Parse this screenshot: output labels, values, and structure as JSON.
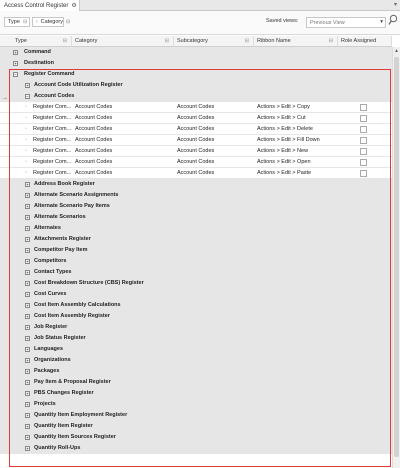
{
  "tab": {
    "title": "Access Control Register",
    "gear_icon": "gear-icon",
    "arrow_icon": "chevron-down-icon"
  },
  "toolbar": {
    "type_chip": "Type",
    "category_chip": "Category",
    "saved_views_label": "Saved views:",
    "saved_views_placeholder": "Previous View",
    "search_icon": "search-icon"
  },
  "columns": {
    "type": "Type",
    "category": "Category",
    "subcategory": "Subcategory",
    "ribbon_name": "Ribbon Name",
    "role_assigned": "Role Assigned"
  },
  "rows": [
    {
      "kind": "group",
      "level": 0,
      "label": "Command",
      "expander": "+"
    },
    {
      "kind": "group",
      "level": 0,
      "label": "Destination",
      "expander": "+"
    },
    {
      "kind": "group",
      "level": 0,
      "label": "Register Command",
      "expander": "−"
    },
    {
      "kind": "group",
      "level": 1,
      "label": "Account Code Utilization Register",
      "expander": "+"
    },
    {
      "kind": "group",
      "level": 1,
      "label": "Account Codes",
      "expander": "−"
    },
    {
      "kind": "data",
      "type": "Register Com...",
      "category": "Account Codes",
      "subcategory": "Account Codes",
      "ribbon": "Actions > Edit > Copy",
      "role_assigned": false
    },
    {
      "kind": "data",
      "type": "Register Com...",
      "category": "Account Codes",
      "subcategory": "Account Codes",
      "ribbon": "Actions > Edit > Cut",
      "role_assigned": false
    },
    {
      "kind": "data",
      "type": "Register Com...",
      "category": "Account Codes",
      "subcategory": "Account Codes",
      "ribbon": "Actions > Edit > Delete",
      "role_assigned": false
    },
    {
      "kind": "data",
      "type": "Register Com...",
      "category": "Account Codes",
      "subcategory": "Account Codes",
      "ribbon": "Actions > Edit > Fill Down",
      "role_assigned": false
    },
    {
      "kind": "data",
      "type": "Register Com...",
      "category": "Account Codes",
      "subcategory": "Account Codes",
      "ribbon": "Actions > Edit > New",
      "role_assigned": false
    },
    {
      "kind": "data",
      "type": "Register Com...",
      "category": "Account Codes",
      "subcategory": "Account Codes",
      "ribbon": "Actions > Edit > Open",
      "role_assigned": false
    },
    {
      "kind": "data",
      "type": "Register Com...",
      "category": "Account Codes",
      "subcategory": "Account Codes",
      "ribbon": "Actions > Edit > Paste",
      "role_assigned": false
    },
    {
      "kind": "group",
      "level": 1,
      "label": "Address Book Register",
      "expander": "+"
    },
    {
      "kind": "group",
      "level": 1,
      "label": "Alternate Scenario Assignments",
      "expander": "+"
    },
    {
      "kind": "group",
      "level": 1,
      "label": "Alternate Scenario Pay Items",
      "expander": "+"
    },
    {
      "kind": "group",
      "level": 1,
      "label": "Alternate Scenarios",
      "expander": "+"
    },
    {
      "kind": "group",
      "level": 1,
      "label": "Alternates",
      "expander": "+"
    },
    {
      "kind": "group",
      "level": 1,
      "label": "Attachments Register",
      "expander": "+"
    },
    {
      "kind": "group",
      "level": 1,
      "label": "Competitor Pay Item",
      "expander": "+"
    },
    {
      "kind": "group",
      "level": 1,
      "label": "Competitors",
      "expander": "+"
    },
    {
      "kind": "group",
      "level": 1,
      "label": "Contact Types",
      "expander": "+"
    },
    {
      "kind": "group",
      "level": 1,
      "label": "Cost Breakdown Structure (CBS) Register",
      "expander": "+"
    },
    {
      "kind": "group",
      "level": 1,
      "label": "Cost Curves",
      "expander": "+"
    },
    {
      "kind": "group",
      "level": 1,
      "label": "Cost Item Assembly Calculations",
      "expander": "+"
    },
    {
      "kind": "group",
      "level": 1,
      "label": "Cost Item Assembly Register",
      "expander": "+"
    },
    {
      "kind": "group",
      "level": 1,
      "label": "Job Register",
      "expander": "+"
    },
    {
      "kind": "group",
      "level": 1,
      "label": "Job Status Register",
      "expander": "+"
    },
    {
      "kind": "group",
      "level": 1,
      "label": "Languages",
      "expander": "+"
    },
    {
      "kind": "group",
      "level": 1,
      "label": "Organizations",
      "expander": "+"
    },
    {
      "kind": "group",
      "level": 1,
      "label": "Packages",
      "expander": "+"
    },
    {
      "kind": "group",
      "level": 1,
      "label": "Pay Item & Proposal Register",
      "expander": "+"
    },
    {
      "kind": "group",
      "level": 1,
      "label": "PBS Changes Register",
      "expander": "+"
    },
    {
      "kind": "group",
      "level": 1,
      "label": "Projects",
      "expander": "+"
    },
    {
      "kind": "group",
      "level": 1,
      "label": "Quantity Item Employment Register",
      "expander": "+"
    },
    {
      "kind": "group",
      "level": 1,
      "label": "Quantity Item Register",
      "expander": "+"
    },
    {
      "kind": "group",
      "level": 1,
      "label": "Quantity Item Sources Register",
      "expander": "+"
    },
    {
      "kind": "group",
      "level": 1,
      "label": "Quantity Roll-Ups",
      "expander": "+"
    }
  ],
  "current_row_marker": "→",
  "colors": {
    "highlight": "#e03a3a",
    "group_bg": "#e6e6e6"
  }
}
